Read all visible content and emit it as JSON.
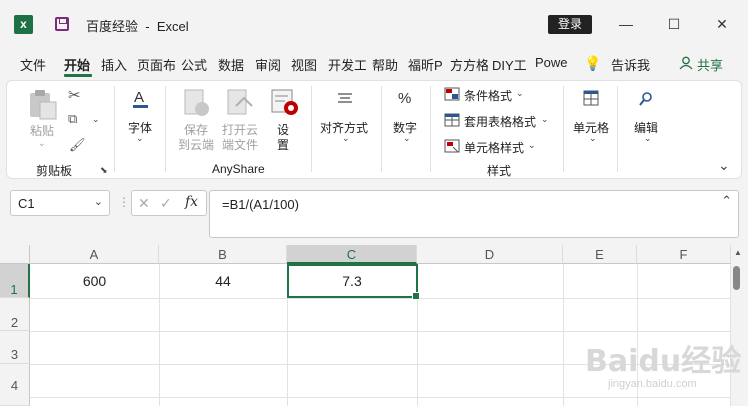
{
  "titlebar": {
    "doc_name": "百度经验",
    "separator": "-",
    "app_name": "Excel",
    "login_label": "登录",
    "minimize": "—",
    "maximize": "☐",
    "close": "✕"
  },
  "tabs": [
    {
      "label": "文件",
      "active": false
    },
    {
      "label": "开始",
      "active": true
    },
    {
      "label": "插入",
      "active": false
    },
    {
      "label": "页面布",
      "active": false
    },
    {
      "label": "公式",
      "active": false
    },
    {
      "label": "数据",
      "active": false
    },
    {
      "label": "审阅",
      "active": false
    },
    {
      "label": "视图",
      "active": false
    },
    {
      "label": "开发工",
      "active": false
    },
    {
      "label": "帮助",
      "active": false
    },
    {
      "label": "福昕P",
      "active": false
    },
    {
      "label": "方方格",
      "active": false
    },
    {
      "label": "DIY工",
      "active": false
    },
    {
      "label": "Powe",
      "active": false
    },
    {
      "label": "告诉我",
      "active": false
    }
  ],
  "share_label": "共享",
  "ribbon": {
    "clipboard": {
      "paste": "粘贴",
      "group": "剪贴板"
    },
    "font": {
      "label": "字体"
    },
    "anyshare": {
      "save_cloud_1": "保存",
      "save_cloud_2": "到云端",
      "open_cloud_1": "打开云",
      "open_cloud_2": "端文件",
      "settings_1": "设",
      "settings_2": "置",
      "group": "AnyShare"
    },
    "align": {
      "label": "对齐方式"
    },
    "number": {
      "label": "数字",
      "icon": "%"
    },
    "styles": {
      "conditional": "条件格式",
      "table_format": "套用表格格式",
      "cell_styles": "单元格样式",
      "group": "样式"
    },
    "cells": {
      "label": "单元格"
    },
    "editing": {
      "label": "编辑"
    }
  },
  "formula_bar": {
    "name_box": "C1",
    "cancel": "✕",
    "confirm": "✓",
    "fx": "fx",
    "formula": "=B1/(A1/100)"
  },
  "sheet": {
    "columns": [
      "A",
      "B",
      "C",
      "D",
      "E",
      "F"
    ],
    "rows": [
      "1",
      "2",
      "3",
      "4"
    ],
    "cells": {
      "A1": "600",
      "B1": "44",
      "C1": "7.3"
    },
    "selected": "C1"
  },
  "watermark": {
    "brand": "Baidu经验",
    "url": "jingyan.baidu.com"
  }
}
